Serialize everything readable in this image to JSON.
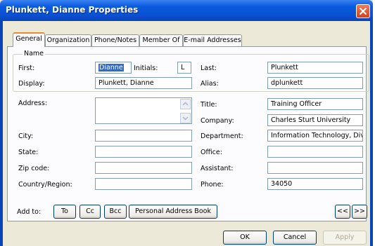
{
  "window": {
    "title": "Plunkett, Dianne Properties"
  },
  "tabs": [
    {
      "label": "General"
    },
    {
      "label": "Organization"
    },
    {
      "label": "Phone/Notes"
    },
    {
      "label": "Member Of"
    },
    {
      "label": "E-mail Addresses"
    }
  ],
  "active_tab": "General",
  "name_group": {
    "legend": "Name",
    "first_label": "First:",
    "first_value": "Dianne",
    "initials_label": "Initials:",
    "initials_value": "L",
    "last_label": "Last:",
    "last_value": "Plunkett",
    "display_label": "Display:",
    "display_value": "Plunkett, Dianne",
    "alias_label": "Alias:",
    "alias_value": "dplunkett"
  },
  "address": {
    "address_label": "Address:",
    "address_value": "",
    "city_label": "City:",
    "city_value": "",
    "state_label": "State:",
    "state_value": "",
    "zip_label": "Zip code:",
    "zip_value": "",
    "country_label": "Country/Region:",
    "country_value": ""
  },
  "work": {
    "title_label": "Title:",
    "title_value": "Training Officer",
    "company_label": "Company:",
    "company_value": "Charles Sturt University",
    "department_label": "Department:",
    "department_value": "Information Technology, Divi",
    "office_label": "Office:",
    "office_value": "",
    "assistant_label": "Assistant:",
    "assistant_value": "",
    "phone_label": "Phone:",
    "phone_value": "34050"
  },
  "add_to": {
    "label": "Add to:",
    "to": "To",
    "cc": "Cc",
    "bcc": "Bcc",
    "pab": "Personal Address Book",
    "prev": "<<",
    "next": ">>"
  },
  "footer": {
    "ok": "OK",
    "cancel": "Cancel",
    "apply": "Apply"
  },
  "colors": {
    "titlebar": "#0a4fd1",
    "active_tab_accent": "#e68b2c",
    "selection": "#316ac5"
  }
}
